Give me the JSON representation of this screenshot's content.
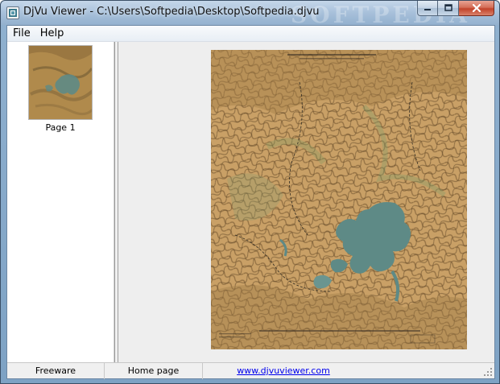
{
  "window": {
    "title": "DjVu Viewer - C:\\Users\\Softpedia\\Desktop\\Softpedia.djvu",
    "watermark": "SOFTPEDIA",
    "app_icon": "djvu-app-icon",
    "buttons": {
      "minimize_icon": "minimize-icon",
      "maximize_icon": "maximize-icon",
      "close_icon": "close-icon"
    }
  },
  "menu": {
    "items": [
      {
        "label": "File"
      },
      {
        "label": "Help"
      }
    ]
  },
  "thumbnails": {
    "pages": [
      {
        "label": "Page 1"
      }
    ]
  },
  "viewer": {
    "document": "topographic map page"
  },
  "statusbar": {
    "license": "Freeware",
    "home": "Home page",
    "website": "www.djvuviewer.com"
  },
  "colors": {
    "frame": "#8fb0cf",
    "client": "#f0f0f0",
    "map_base": "#c9a066",
    "map_water": "#5e8a86",
    "link": "#0000ee",
    "close": "#c2432a"
  }
}
